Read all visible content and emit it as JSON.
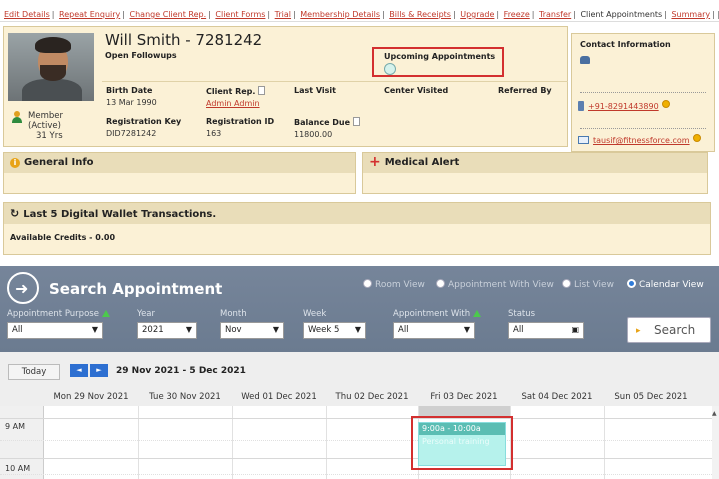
{
  "nav": {
    "links": [
      "Edit Details",
      "Repeat Enquiry",
      "Change Client Rep.",
      "Client Forms",
      "Trial",
      "Membership Details",
      "Bills & Receipts",
      "Upgrade",
      "Freeze",
      "Transfer"
    ],
    "current": "Client Appointments",
    "summary": "Summary"
  },
  "profile": {
    "name": "Will Smith - 7281242",
    "followups": "Open Followups",
    "upcoming_label": "Upcoming Appointments",
    "member_label": "Member",
    "member_status": "(Active)",
    "age": "31 Yrs",
    "birth_date_label": "Birth Date",
    "birth_date": "13 Mar 1990",
    "client_rep_label": "Client Rep.",
    "client_rep": "Admin Admin",
    "last_visit_label": "Last Visit",
    "center_visited_label": "Center Visited",
    "referred_by_label": "Referred By",
    "reg_key_label": "Registration Key",
    "reg_key": "DID7281242",
    "reg_id_label": "Registration ID",
    "reg_id": "163",
    "balance_label": "Balance Due",
    "balance": "11800.00"
  },
  "contact": {
    "title": "Contact Information",
    "phone": "+91-8291443890",
    "email": "tausif@fitnessforce.com"
  },
  "general_info": {
    "title": "General Info"
  },
  "medical": {
    "title": "Medical Alert"
  },
  "wallet": {
    "title": "Last 5 Digital Wallet Transactions.",
    "credits": "Available Credits - 0.00"
  },
  "search": {
    "title": "Search Appointment",
    "views": [
      "Room View",
      "Appointment With View",
      "List View",
      "Calendar View"
    ],
    "selected_view": "Calendar View",
    "labels": {
      "purpose": "Appointment Purpose",
      "year": "Year",
      "month": "Month",
      "week": "Week",
      "with": "Appointment With",
      "status": "Status"
    },
    "values": {
      "purpose": "All",
      "year": "2021",
      "month": "Nov",
      "week": "Week 5",
      "with": "All",
      "status": "All"
    },
    "button": "Search"
  },
  "calendar": {
    "today": "Today",
    "prev": "◄",
    "next": "►",
    "range": "29 Nov 2021 - 5 Dec 2021",
    "days": [
      "Mon 29 Nov 2021",
      "Tue 30 Nov 2021",
      "Wed 01 Dec 2021",
      "Thu 02 Dec 2021",
      "Fri 03 Dec 2021",
      "Sat 04 Dec 2021",
      "Sun 05 Dec 2021"
    ],
    "times": [
      "9 AM",
      "10 AM"
    ],
    "appointment": {
      "time": "9:00a - 10:00a",
      "name": "Personal training"
    }
  },
  "colors": {
    "link": "#c0392b",
    "panel_bg": "#fbf1d6",
    "search_bar": "#6b7b90",
    "appointment": "#b6f2ec",
    "highlight": "#d32f2f"
  }
}
